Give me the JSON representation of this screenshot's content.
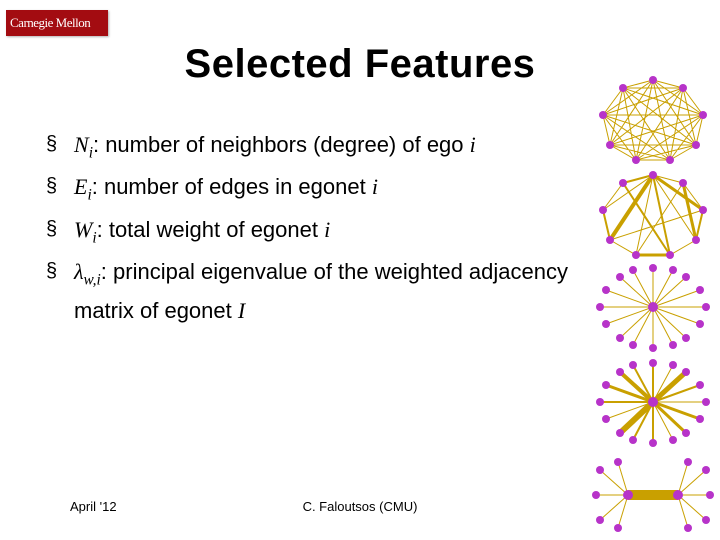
{
  "logo": "Carnegie Mellon",
  "title": "Selected Features",
  "bullets": [
    {
      "sym": "N",
      "sub": "i",
      "text": ": number of neighbors (degree) of ego ",
      "tail_i": "i"
    },
    {
      "sym": "E",
      "sub": "i",
      "text": ": number of edges in egonet ",
      "tail_i": "i"
    },
    {
      "sym": "W",
      "sub": "i",
      "text": ": total weight of egonet ",
      "tail_i": "i"
    },
    {
      "sym": "λ",
      "sub": "w,i",
      "text": ": principal eigenvalue of the weighted adjacency matrix of egonet ",
      "tail_i": "I"
    }
  ],
  "footer": {
    "left": "April '12",
    "center": "C. Faloutsos (CMU)"
  }
}
